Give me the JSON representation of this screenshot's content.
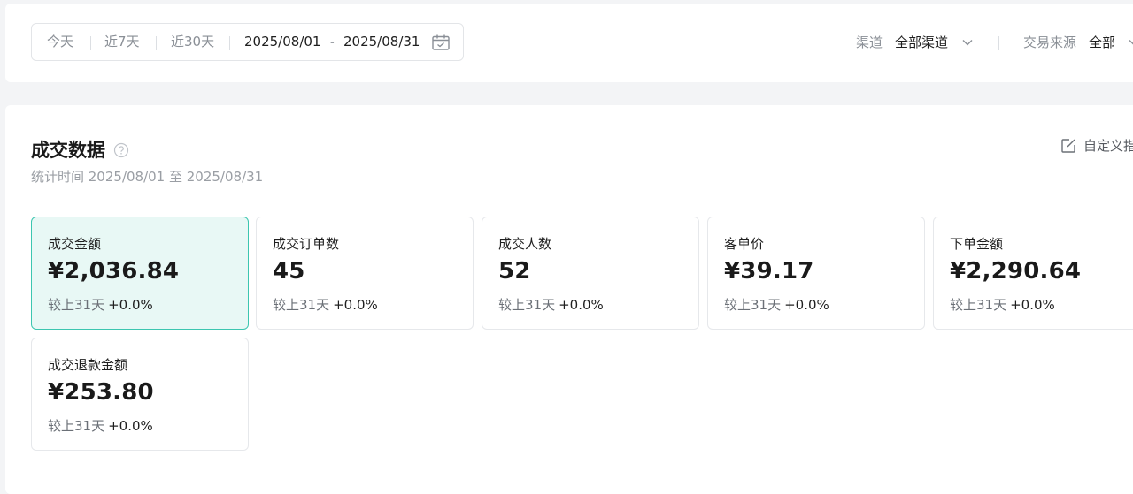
{
  "filter": {
    "quick_ranges": [
      "今天",
      "近7天",
      "近30天"
    ],
    "start_date": "2025/08/01",
    "end_date": "2025/08/31",
    "separator": "-",
    "channel_label": "渠道",
    "channel_value": "全部渠道",
    "source_label": "交易来源",
    "source_value": "全部"
  },
  "section": {
    "title": "成交数据",
    "subtitle": "统计时间 2025/08/01 至 2025/08/31",
    "custom_label": "自定义指标"
  },
  "metrics": [
    {
      "label": "成交金额",
      "value": "¥2,036.84",
      "compare_prefix": "较上31天",
      "compare_delta": "+0.0%"
    },
    {
      "label": "成交订单数",
      "value": "45",
      "compare_prefix": "较上31天",
      "compare_delta": "+0.0%"
    },
    {
      "label": "成交人数",
      "value": "52",
      "compare_prefix": "较上31天",
      "compare_delta": "+0.0%"
    },
    {
      "label": "客单价",
      "value": "¥39.17",
      "compare_prefix": "较上31天",
      "compare_delta": "+0.0%"
    },
    {
      "label": "下单金额",
      "value": "¥2,290.64",
      "compare_prefix": "较上31天",
      "compare_delta": "+0.0%"
    },
    {
      "label": "成交退款金额",
      "value": "¥253.80",
      "compare_prefix": "较上31天",
      "compare_delta": "+0.0%"
    }
  ],
  "colors": {
    "accent": "#3cc6b0",
    "active_card_bg": "#e8f8f5"
  },
  "icons": {
    "calendar": "calendar-icon",
    "chevron": "chevron-down-icon",
    "help": "question-circle-icon",
    "edit": "edit-icon"
  }
}
